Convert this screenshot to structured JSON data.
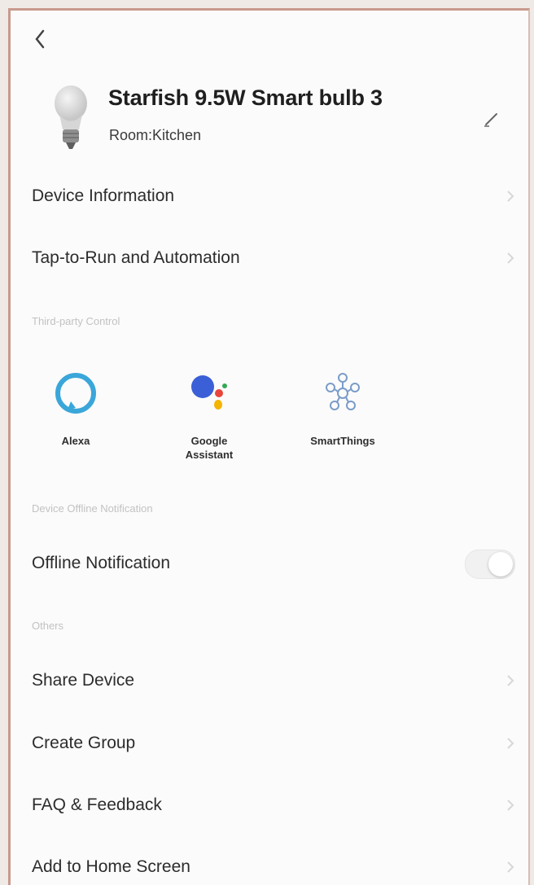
{
  "header": {
    "back_icon": "chevron-left-icon",
    "device_name": "Starfish 9.5W Smart bulb 3",
    "room": "Room:Kitchen",
    "edit_icon": "pencil-icon"
  },
  "menu_top": [
    {
      "label": "Device Information"
    },
    {
      "label": "Tap-to-Run and Automation"
    }
  ],
  "third_party": {
    "section_title": "Third-party Control",
    "items": [
      {
        "name": "Alexa",
        "icon": "alexa-icon"
      },
      {
        "name_line1": "Google",
        "name_line2": "Assistant",
        "icon": "google-assistant-icon"
      },
      {
        "name": "SmartThings",
        "icon": "smartthings-icon"
      }
    ]
  },
  "offline": {
    "section_title": "Device Offline Notification",
    "label": "Offline Notification",
    "enabled": false
  },
  "others": {
    "section_title": "Others",
    "items": [
      {
        "label": "Share Device"
      },
      {
        "label": "Create Group"
      },
      {
        "label": "FAQ & Feedback"
      },
      {
        "label": "Add to Home Screen"
      }
    ]
  },
  "colors": {
    "alexa": "#3aa6d9",
    "google_blue": "#3b5fd6",
    "google_red": "#e8453c",
    "google_yellow": "#f4b400",
    "google_green": "#34a853",
    "smartthings": "#7a9cc9"
  }
}
